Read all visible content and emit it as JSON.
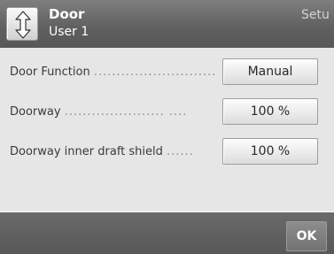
{
  "header": {
    "title": "Door",
    "subtitle": "User 1",
    "section_label": "Setu",
    "nav_icon": "up-down-arrows-icon"
  },
  "settings": [
    {
      "label": "Door Function",
      "dots": "...........................",
      "value": "Manual"
    },
    {
      "label": "Doorway",
      "dots": "......................   ....",
      "value": "100 %"
    },
    {
      "label": "Doorway inner draft shield",
      "dots": "......",
      "value": "100 %"
    }
  ],
  "footer": {
    "ok_label": "OK"
  }
}
